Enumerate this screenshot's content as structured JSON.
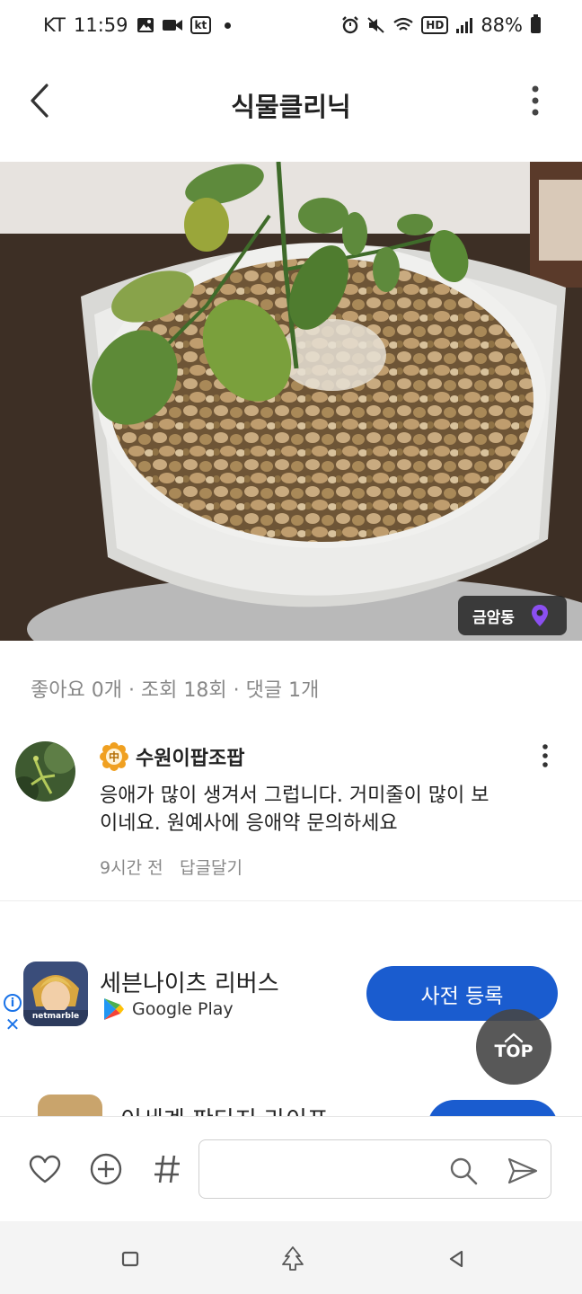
{
  "status_bar": {
    "carrier": "KT",
    "time": "11:59",
    "kt_badge": "kt",
    "hd_badge": "HD",
    "battery": "88%"
  },
  "header": {
    "title": "식물클리닉"
  },
  "photo": {
    "location": "금암동"
  },
  "stats": {
    "text": "좋아요 0개 · 조회 18회 · 댓글 1개"
  },
  "comment": {
    "author": "수원이팝조팝",
    "badge": "中",
    "text": "응애가 많이 생겨서 그럽니다. 거미줄이 많이 보이네요. 원예사에 응애약 문의하세요",
    "time": "9시간 전",
    "reply": "답글달기"
  },
  "ad": {
    "app_label": "netmarble",
    "title": "세븐나이츠 리버스",
    "store": "Google Play",
    "cta": "사전 등록",
    "info": "i",
    "close": "✕"
  },
  "ad2": {
    "title": "이세계 판다지 라이프"
  },
  "top_button": {
    "label": "TOP"
  },
  "bottom_bar": {
    "input_placeholder": ""
  },
  "colors": {
    "accent": "#1a5ccf",
    "location_pin": "#8b4ff0",
    "badge": "#f0a020"
  }
}
